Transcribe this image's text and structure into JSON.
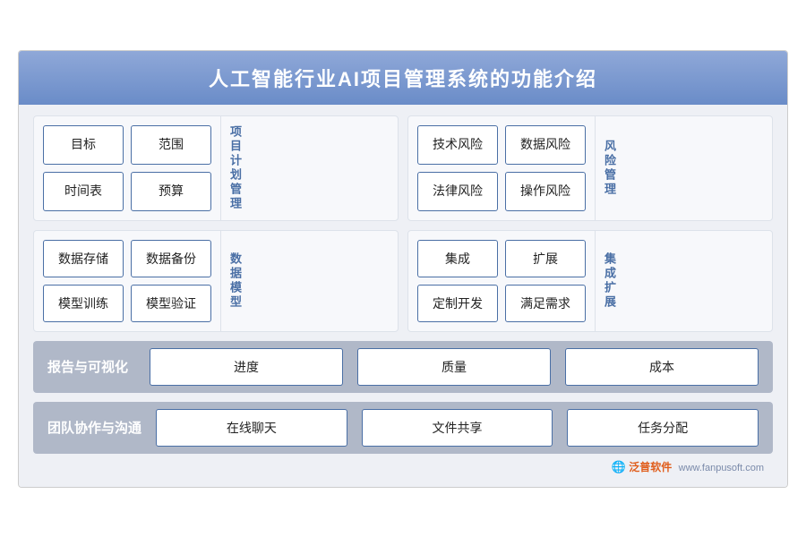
{
  "title": "人工智能行业AI项目管理系统的功能介绍",
  "section1": {
    "label": "项目计划管理",
    "cells": [
      "目标",
      "范围",
      "时间表",
      "预算"
    ]
  },
  "section2": {
    "label": "风险管理",
    "cells": [
      "技术风险",
      "数据风险",
      "法律风险",
      "操作风险"
    ]
  },
  "section3": {
    "label": "数据模型",
    "cells": [
      "数据存储",
      "数据备份",
      "模型训练",
      "模型验证"
    ]
  },
  "section4": {
    "label": "集成扩展",
    "cells": [
      "集成",
      "扩展",
      "定制开发",
      "满足需求"
    ]
  },
  "row1": {
    "label": "报告与可视化",
    "cells": [
      "进度",
      "质量",
      "成本"
    ]
  },
  "row2": {
    "label": "团队协作与沟通",
    "cells": [
      "在线聊天",
      "文件共享",
      "任务分配"
    ]
  },
  "logo": {
    "brand": "泛普软件",
    "url": "www.fanpusoft.com"
  }
}
